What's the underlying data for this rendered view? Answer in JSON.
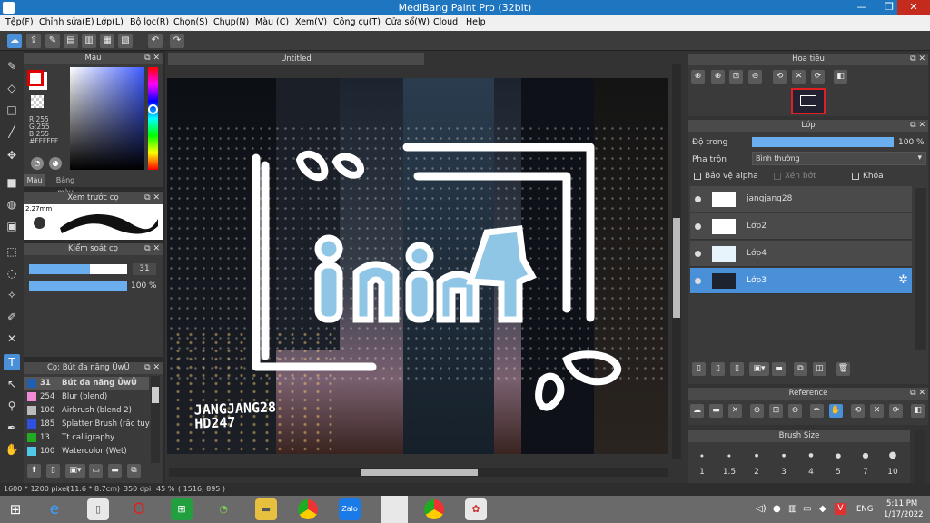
{
  "window": {
    "title": "MediBang Paint Pro (32bit)",
    "minimize": "—",
    "restore": "❐",
    "close": "✕"
  },
  "menu": [
    "Tệp(F)",
    "Chỉnh sửa(E)",
    "Lớp(L)",
    "Bộ lọc(R)",
    "Chọn(S)",
    "Chụp(N)",
    "Màu (C)",
    "Xem(V)",
    "Công cụ(T)",
    "Cửa sổ(W)",
    "Cloud",
    "Help"
  ],
  "color_panel": {
    "title": "Màu",
    "r": "R:255",
    "g": "G:255",
    "b": "B:255",
    "hex": "#FFFFFF",
    "tabs": [
      "Màu",
      "Bảng màu"
    ],
    "primary": "#e00000",
    "secondary": "#ffffff"
  },
  "brush_preview": {
    "title": "Xem trước cọ",
    "size": "2.27mm"
  },
  "brush_control": {
    "title": "Kiểm soát cọ",
    "size_value": "31",
    "size_fill": 0.62,
    "opacity_value": "100 %",
    "opacity_fill": 1.0
  },
  "brush_list": {
    "title": "Cọ: Bút đa năng ŪwŪ",
    "items": [
      {
        "size": "31",
        "name": "Bút đa năng ŪwŪ",
        "color": "#1e5fb4",
        "selected": true
      },
      {
        "size": "254",
        "name": "Blur (blend)",
        "color": "#f08cd6",
        "selected": false
      },
      {
        "size": "100",
        "name": "Airbrush (blend 2)",
        "color": "#bbbbbb",
        "selected": false
      },
      {
        "size": "185",
        "name": "Splatter Brush (rắc tuy",
        "color": "#3050e0",
        "selected": false
      },
      {
        "size": "13",
        "name": "Tt calligraphy",
        "color": "#22aa22",
        "selected": false
      },
      {
        "size": "100",
        "name": "Watercolor (Wet)",
        "color": "#50c8e8",
        "selected": false
      }
    ]
  },
  "canvas": {
    "tab": "Untitled",
    "artwork_text": "JANGJANG28\nHD247"
  },
  "status_bar": {
    "size": "1600 * 1200 pixel",
    "physical": "(11.6 * 8.7cm)",
    "dpi": "350 dpi",
    "zoom": "45 %",
    "coords": "( 1516, 895 )"
  },
  "navigator": {
    "title": "Hoa tiêu"
  },
  "layer_panel": {
    "title": "Lớp",
    "opacity_label": "Độ trong",
    "opacity_value": "100 %",
    "opacity_fill": 1.0,
    "blend_label": "Pha trộn",
    "blend_value": "Bình thường",
    "protect_alpha": "Bảo vệ alpha",
    "clipping": "Xén bớt",
    "lock": "Khóa",
    "layers": [
      {
        "name": "jangjang28",
        "selected": false
      },
      {
        "name": "Lớp2",
        "selected": false
      },
      {
        "name": "Lớp4",
        "selected": false
      },
      {
        "name": "Lớp3",
        "selected": true
      }
    ]
  },
  "reference": {
    "title": "Reference"
  },
  "brush_size": {
    "title": "Brush Size",
    "sizes": [
      "1",
      "1.5",
      "2",
      "3",
      "4",
      "5",
      "7",
      "10"
    ]
  },
  "taskbar": {
    "lang": "ENG",
    "time": "5:11 PM",
    "date": "1/17/2022"
  }
}
